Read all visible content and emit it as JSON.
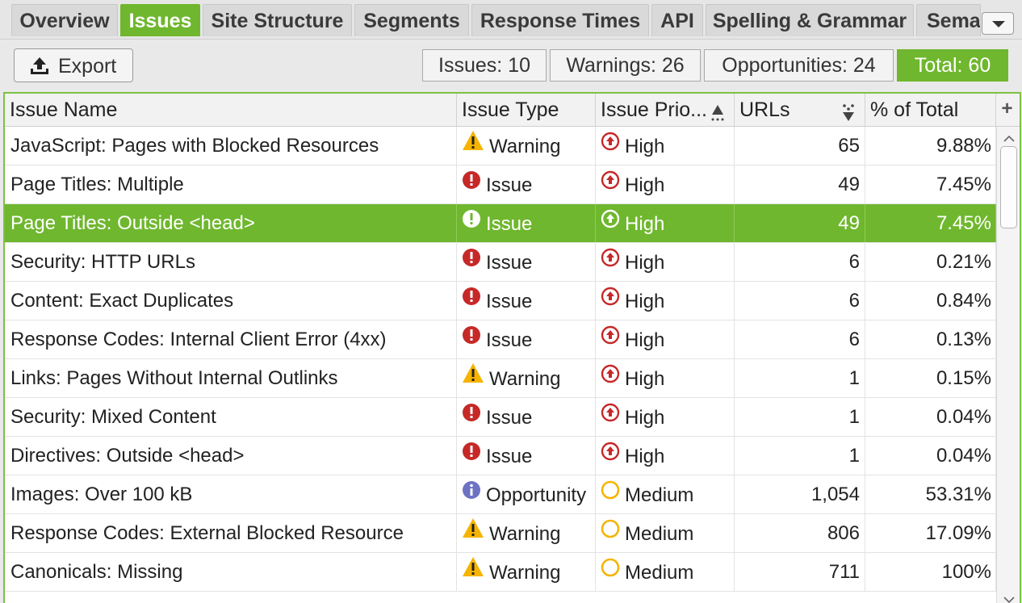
{
  "tabs": [
    {
      "label": "Overview",
      "active": false
    },
    {
      "label": "Issues",
      "active": true
    },
    {
      "label": "Site Structure",
      "active": false
    },
    {
      "label": "Segments",
      "active": false
    },
    {
      "label": "Response Times",
      "active": false
    },
    {
      "label": "API",
      "active": false
    },
    {
      "label": "Spelling & Grammar",
      "active": false
    },
    {
      "label": "Sema",
      "active": false
    }
  ],
  "toolbar": {
    "export_label": "Export",
    "stats": {
      "issues": "Issues: 10",
      "warnings": "Warnings: 26",
      "opportunities": "Opportunities: 24",
      "total": "Total: 60"
    }
  },
  "table": {
    "columns": {
      "name": "Issue Name",
      "type": "Issue Type",
      "priority": "Issue Prio...",
      "urls": "URLs",
      "pct": "% of Total"
    },
    "add_column": "+",
    "rows": [
      {
        "name": "JavaScript: Pages with Blocked Resources",
        "type": "Warning",
        "priority": "High",
        "urls": "65",
        "pct": "9.88%"
      },
      {
        "name": "Page Titles: Multiple",
        "type": "Issue",
        "priority": "High",
        "urls": "49",
        "pct": "7.45%"
      },
      {
        "name": "Page Titles: Outside <head>",
        "type": "Issue",
        "priority": "High",
        "urls": "49",
        "pct": "7.45%"
      },
      {
        "name": "Security: HTTP URLs",
        "type": "Issue",
        "priority": "High",
        "urls": "6",
        "pct": "0.21%"
      },
      {
        "name": "Content: Exact Duplicates",
        "type": "Issue",
        "priority": "High",
        "urls": "6",
        "pct": "0.84%"
      },
      {
        "name": "Response Codes: Internal Client Error (4xx)",
        "type": "Issue",
        "priority": "High",
        "urls": "6",
        "pct": "0.13%"
      },
      {
        "name": "Links: Pages Without Internal Outlinks",
        "type": "Warning",
        "priority": "High",
        "urls": "1",
        "pct": "0.15%"
      },
      {
        "name": "Security: Mixed Content",
        "type": "Issue",
        "priority": "High",
        "urls": "1",
        "pct": "0.04%"
      },
      {
        "name": "Directives: Outside <head>",
        "type": "Issue",
        "priority": "High",
        "urls": "1",
        "pct": "0.04%"
      },
      {
        "name": "Images: Over 100 kB",
        "type": "Opportunity",
        "priority": "Medium",
        "urls": "1,054",
        "pct": "53.31%"
      },
      {
        "name": "Response Codes: External Blocked Resource",
        "type": "Warning",
        "priority": "Medium",
        "urls": "806",
        "pct": "17.09%"
      },
      {
        "name": "Canonicals: Missing",
        "type": "Warning",
        "priority": "Medium",
        "urls": "711",
        "pct": "100%"
      }
    ],
    "selected_row": 2
  },
  "colors": {
    "accent": "#6fb72e",
    "issue": "#c62828",
    "warning": "#f5b400",
    "opportunity": "#6d72c3",
    "high": "#c62828",
    "medium": "#f5b400"
  },
  "icons": {
    "export": "export-icon",
    "tab_menu": "chevron-down-icon",
    "issue": "issue-exclamation-icon",
    "warning": "warning-triangle-icon",
    "opportunity": "info-icon",
    "high": "high-priority-arrow-icon",
    "medium": "medium-priority-circle-icon"
  }
}
